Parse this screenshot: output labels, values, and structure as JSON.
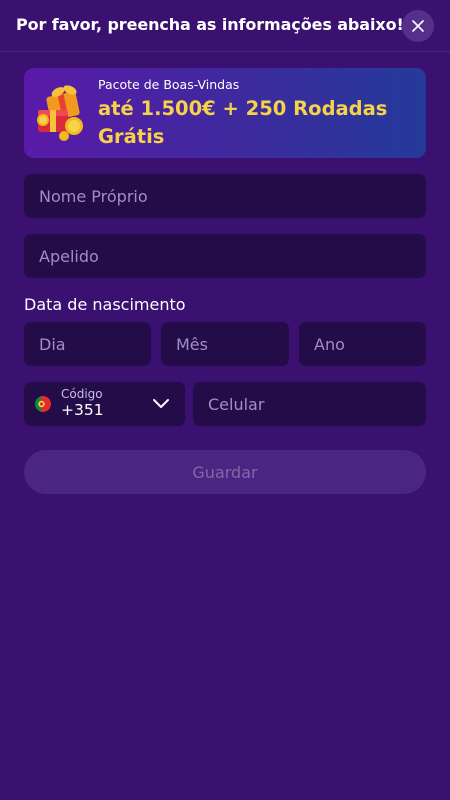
{
  "header": {
    "title": "Por favor, preencha as informações abaixo!",
    "close_icon": "close-icon"
  },
  "banner": {
    "subtitle": "Pacote de Boas-Vindas",
    "offer": "até 1.500€ + 250 Rodadas Grátis",
    "icon": "gift-box-icon"
  },
  "form": {
    "first_name_placeholder": "Nome Próprio",
    "last_name_placeholder": "Apelido",
    "birth_label": "Data de nascimento",
    "day_placeholder": "Dia",
    "month_placeholder": "Mês",
    "year_placeholder": "Ano",
    "code_label": "Código",
    "code_value": "+351",
    "phone_placeholder": "Celular",
    "save_label": "Guardar"
  },
  "colors": {
    "background": "#3a1170",
    "field_bg": "#230c48",
    "accent_yellow": "#f6d24a",
    "button_disabled": "#4a2682"
  }
}
